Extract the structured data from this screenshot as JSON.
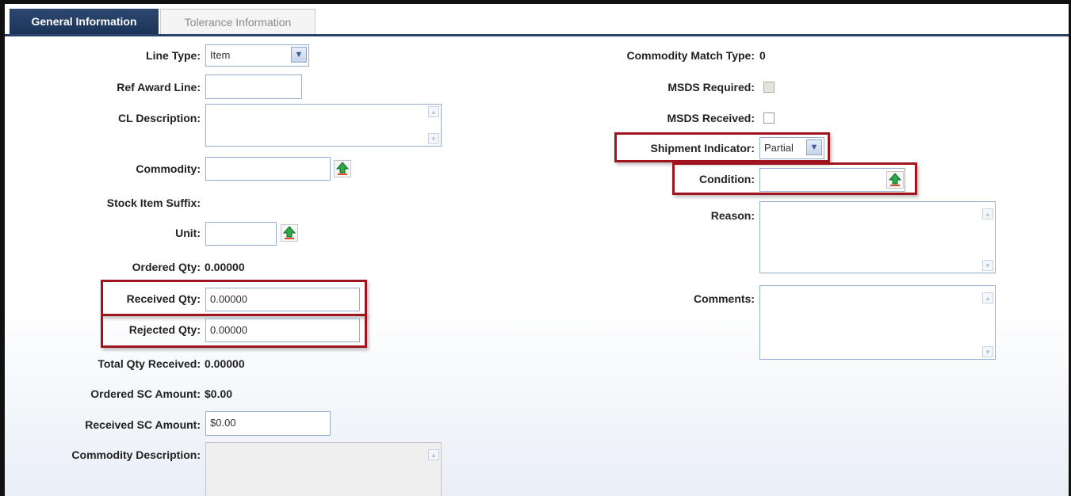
{
  "tabs": [
    {
      "label": "General Information",
      "active": true
    },
    {
      "label": "Tolerance Information",
      "active": false
    }
  ],
  "left": {
    "line_type": {
      "label": "Line Type:",
      "value": "Item"
    },
    "ref_award_line": {
      "label": "Ref Award Line:",
      "value": ""
    },
    "cl_description": {
      "label": "CL Description:",
      "value": ""
    },
    "commodity": {
      "label": "Commodity:",
      "value": ""
    },
    "stock_item_suffix": {
      "label": "Stock Item Suffix:",
      "value": ""
    },
    "unit": {
      "label": "Unit:",
      "value": ""
    },
    "ordered_qty": {
      "label": "Ordered Qty:",
      "value": "0.00000"
    },
    "received_qty": {
      "label": "Received Qty:",
      "value": "0.00000"
    },
    "rejected_qty": {
      "label": "Rejected Qty:",
      "value": "0.00000"
    },
    "total_qty_received": {
      "label": "Total Qty Received:",
      "value": "0.00000"
    },
    "ordered_sc_amount": {
      "label": "Ordered SC Amount:",
      "value": "$0.00"
    },
    "received_sc_amount": {
      "label": "Received SC Amount:",
      "value": "$0.00"
    },
    "commodity_description": {
      "label": "Commodity Description:",
      "value": ""
    }
  },
  "right": {
    "commodity_match_type": {
      "label": "Commodity Match Type:",
      "value": "0"
    },
    "msds_required": {
      "label": "MSDS Required:",
      "checked": false,
      "disabled": true
    },
    "msds_received": {
      "label": "MSDS Received:",
      "checked": false
    },
    "shipment_indicator": {
      "label": "Shipment Indicator:",
      "value": "Partial"
    },
    "condition": {
      "label": "Condition:",
      "value": ""
    },
    "reason": {
      "label": "Reason:",
      "value": ""
    },
    "comments": {
      "label": "Comments:",
      "value": ""
    }
  },
  "icons": {
    "dropdown": "chevron-down-icon",
    "lookup": "green-up-arrow-icon",
    "scroll_up": "scroll-up-icon",
    "scroll_down": "scroll-down-icon"
  },
  "colors": {
    "tab_active_bg": "#1f3a63",
    "highlight_border": "#a01420",
    "field_border": "#93acd0"
  }
}
